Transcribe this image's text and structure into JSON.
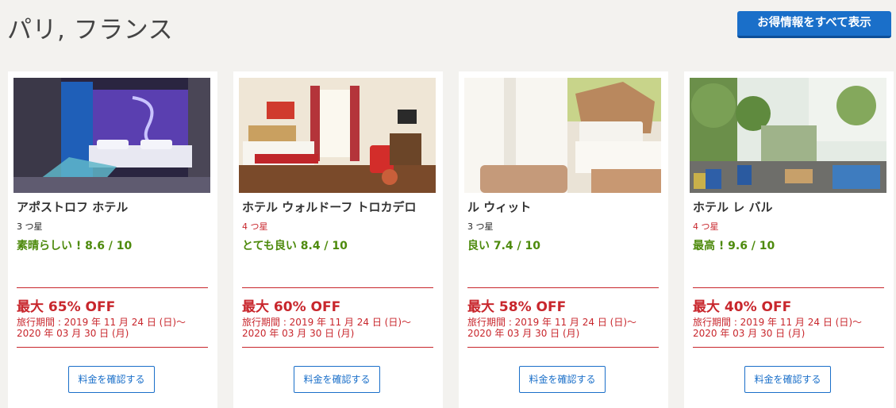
{
  "header": {
    "title": "パリ, フランス",
    "all_deals_label": "お得情報をすべて表示"
  },
  "hotels": [
    {
      "name": "アポストロフ ホテル",
      "stars": "3 つ星",
      "rating": "素晴らしい ! 8.6 / 10",
      "discount": "最大 65% OFF",
      "period_line1": "旅行期間 : 2019 年 11 月 24 日 (日)～",
      "period_line2": "2020 年 03 月 30 日 (月)",
      "button_label": "料金を確認する"
    },
    {
      "name": "ホテル ウォルドーフ トロカデロ",
      "stars": "4 つ星",
      "rating": "とても良い 8.4 / 10",
      "discount": "最大 60% OFF",
      "period_line1": "旅行期間 : 2019 年 11 月 24 日 (日)～",
      "period_line2": "2020 年 03 月 30 日 (月)",
      "button_label": "料金を確認する"
    },
    {
      "name": "ル ウィット",
      "stars": "3 つ星",
      "rating": "良い 7.4 / 10",
      "discount": "最大 58% OFF",
      "period_line1": "旅行期間 : 2019 年 11 月 24 日 (日)～",
      "period_line2": "2020 年 03 月 30 日 (月)",
      "button_label": "料金を確認する"
    },
    {
      "name": "ホテル レ バル",
      "stars": "4 つ星",
      "rating": "最高 ! 9.6 / 10",
      "discount": "最大 40% OFF",
      "period_line1": "旅行期間 : 2019 年 11 月 24 日 (日)～",
      "period_line2": "2020 年 03 月 30 日 (月)",
      "button_label": "料金を確認する"
    }
  ],
  "colors": {
    "background": "#f3f2ef",
    "brand_blue": "#1a6fc9",
    "deal_red": "#c8262c",
    "rating_green": "#4d8a0c"
  }
}
